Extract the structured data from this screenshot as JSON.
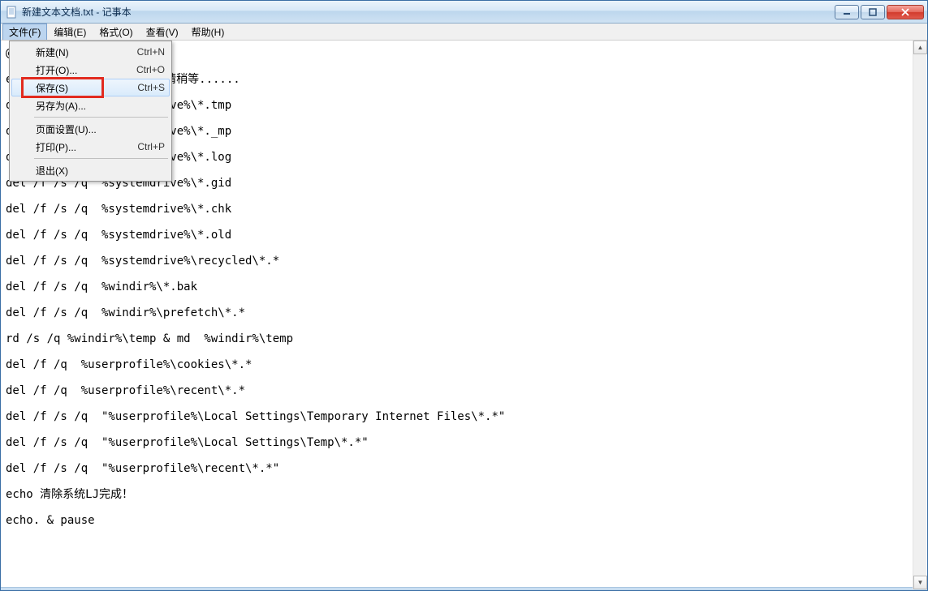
{
  "window": {
    "title": "新建文本文档.txt - 记事本"
  },
  "menubar": {
    "items": [
      {
        "label": "文件(F)"
      },
      {
        "label": "编辑(E)"
      },
      {
        "label": "格式(O)"
      },
      {
        "label": "查看(V)"
      },
      {
        "label": "帮助(H)"
      }
    ]
  },
  "file_menu": {
    "items": [
      {
        "label": "新建(N)",
        "shortcut": "Ctrl+N"
      },
      {
        "label": "打开(O)...",
        "shortcut": "Ctrl+O"
      },
      {
        "label": "保存(S)",
        "shortcut": "Ctrl+S",
        "hover": true
      },
      {
        "label": "另存为(A)...",
        "shortcut": ""
      },
      {
        "sep": true
      },
      {
        "label": "页面设置(U)...",
        "shortcut": ""
      },
      {
        "label": "打印(P)...",
        "shortcut": "Ctrl+P"
      },
      {
        "sep": true
      },
      {
        "label": "退出(X)",
        "shortcut": ""
      }
    ]
  },
  "editor": {
    "lines": [
      "@echo off",
      "",
      "echo 正在清除系统垃圾文件，请稍等......",
      "",
      "del /f /s /q  %systemdrive%\\*.tmp",
      "",
      "del /f /s /q  %systemdrive%\\*._mp",
      "",
      "del /f /s /q  %systemdrive%\\*.log",
      "",
      "del /f /s /q  %systemdrive%\\*.gid",
      "",
      "del /f /s /q  %systemdrive%\\*.chk",
      "",
      "del /f /s /q  %systemdrive%\\*.old",
      "",
      "del /f /s /q  %systemdrive%\\recycled\\*.*",
      "",
      "del /f /s /q  %windir%\\*.bak",
      "",
      "del /f /s /q  %windir%\\prefetch\\*.*",
      "",
      "rd /s /q %windir%\\temp & md  %windir%\\temp",
      "",
      "del /f /q  %userprofile%\\cookies\\*.*",
      "",
      "del /f /q  %userprofile%\\recent\\*.*",
      "",
      "del /f /s /q  \"%userprofile%\\Local Settings\\Temporary Internet Files\\*.*\"",
      "",
      "del /f /s /q  \"%userprofile%\\Local Settings\\Temp\\*.*\"",
      "",
      "del /f /s /q  \"%userprofile%\\recent\\*.*\"",
      "",
      "echo 清除系统LJ完成！",
      "",
      "echo. & pause"
    ]
  }
}
